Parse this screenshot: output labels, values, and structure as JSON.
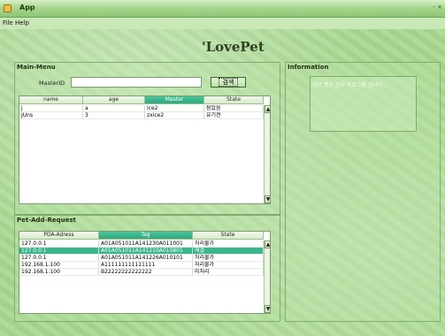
{
  "window": {
    "title": "App",
    "controls": "- ×"
  },
  "menu": {
    "file": "File",
    "help": "Help"
  },
  "logo": {
    "text": "'LovePet"
  },
  "main_menu": {
    "title": "Main-Menu",
    "master_label": "MasterID",
    "master_value": "",
    "search_label": "검색",
    "columns": [
      "name",
      "age",
      "Master",
      "State"
    ],
    "active_column": "Master",
    "rows": [
      [
        "j",
        "a",
        "ice2",
        "잠았음"
      ],
      [
        "JUns",
        "3",
        "zxice2",
        "유기견"
      ]
    ]
  },
  "requests": {
    "title": "Pet-Add-Request",
    "columns": [
      "PDA-Adress",
      "Tag",
      "State"
    ],
    "active_column": "Tag",
    "selected_row": 1,
    "rows": [
      [
        "127.0.0.1",
        "A01A051011A141230A011001",
        "처리불가"
      ],
      [
        "127.0.0.1",
        "A01A051011A141210A010801",
        "해결"
      ],
      [
        "127.0.0.1",
        "A01A051011A141226A010101",
        "처리불가"
      ],
      [
        "192.168.1.100",
        "A111111111111111",
        "처리불가"
      ],
      [
        "192.168.1.100",
        "B22222222222222",
        "미처리"
      ]
    ]
  },
  "information": {
    "title": "Information",
    "text": "러브 펫츠 관리 프로그램 입니다."
  },
  "icons": {
    "app": "app-icon",
    "scroll_up": "scroll-up-icon",
    "scroll_down": "scroll-down-icon"
  }
}
